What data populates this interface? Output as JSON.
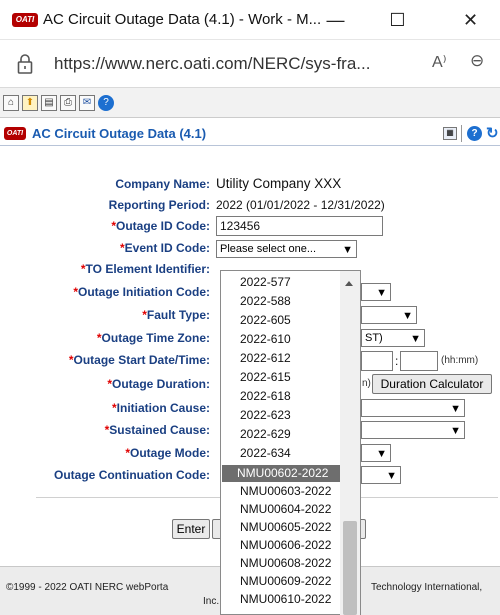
{
  "window": {
    "title": "AC Circuit Outage Data (4.1) - Work - M...",
    "logo_text": "OATI",
    "minimize": "—",
    "maximize": "☐",
    "close": "✕"
  },
  "address": {
    "url": "https://www.nerc.oati.com/NERC/sys-fra...",
    "read_aloud_icon": "A⁾",
    "zoom_icon": "⊖"
  },
  "toolbar": {
    "icons": [
      "home-icon",
      "up-arrow-icon",
      "copy-icon",
      "print-icon",
      "mail-icon",
      "help-icon"
    ]
  },
  "app": {
    "logo_text": "OATI",
    "title": "AC Circuit Outage Data (4.1)",
    "help_glyph": "?",
    "refresh_glyph": "↻"
  },
  "form": {
    "company_name_label": "Company Name:",
    "company_name": "Utility Company XXX",
    "reporting_period_label": "Reporting Period:",
    "reporting_period": "2022 (01/01/2022 - 12/31/2022)",
    "outage_id_label": "Outage ID Code:",
    "outage_id": "123456",
    "event_id_label": "Event ID Code:",
    "event_id_value": "Please select one...",
    "to_element_label": "TO Element Identifier:",
    "initiation_code_label": "Outage Initiation Code:",
    "fault_type_label": "Fault Type:",
    "time_zone_label": "Outage Time Zone:",
    "time_zone_partial": "ST)",
    "start_label": "Outage Start Date/Time:",
    "time_sep": ":",
    "time_hint": "(hh:mm)",
    "duration_label": "Outage Duration:",
    "duration_hint_partial": "n)",
    "duration_calc_button": "Duration Calculator",
    "initiation_cause_label": "Initiation Cause:",
    "sustained_cause_label": "Sustained Cause:",
    "mode_label": "Outage Mode:",
    "continuation_label": "Outage Continuation Code:",
    "enter_button": "Enter",
    "required_marker": "*"
  },
  "dropdown": {
    "options": [
      "2022-577",
      "2022-588",
      "2022-605",
      "2022-610",
      "2022-612",
      "2022-615",
      "2022-618",
      "2022-623",
      "2022-629",
      "2022-634"
    ],
    "selected": "NMU00602-2022",
    "options_after": [
      "NMU00603-2022",
      "NMU00604-2022",
      "NMU00605-2022",
      "NMU00606-2022",
      "NMU00608-2022",
      "NMU00609-2022",
      "NMU00610-2022"
    ]
  },
  "footer": {
    "copyright": "©1999 - 2022 OATI NERC webPorta",
    "company": "Technology International,",
    "suffix": "Inc."
  }
}
